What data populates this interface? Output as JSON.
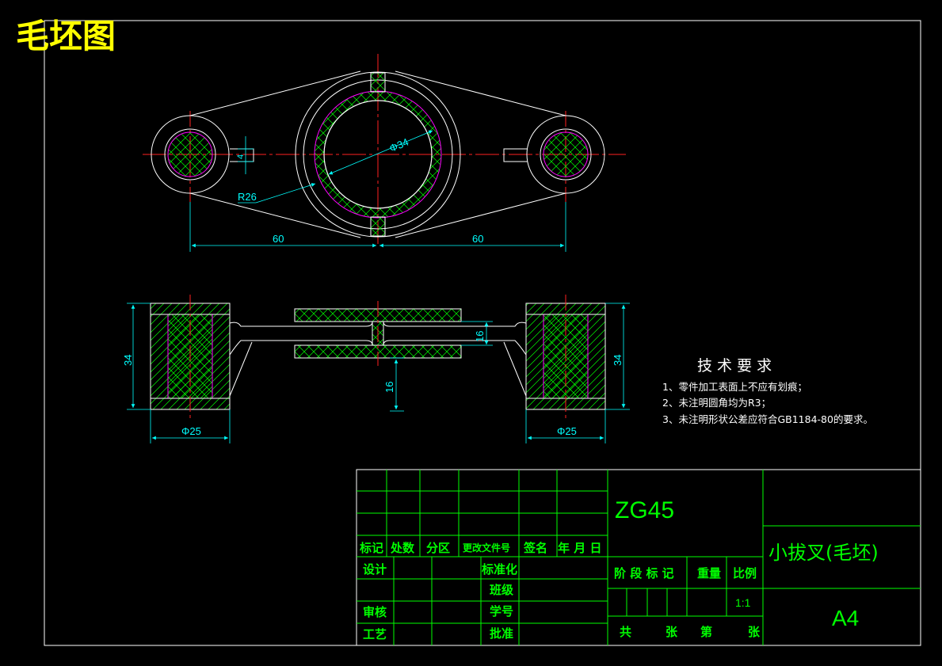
{
  "drawing": {
    "title": "毛坯图",
    "colors": {
      "background": "#000000",
      "outline": "#ffffff",
      "dimension": "#00ffff",
      "hatch": "#00ff00",
      "centerline": "#ff2020",
      "inner": "#ff00ff",
      "title_text": "#ffff00",
      "table": "#00ff00"
    },
    "dimensions": {
      "top_left_span": "60",
      "top_right_span": "60",
      "bore_diameter": "Φ34",
      "arc_radius": "R26",
      "slot_width": "4",
      "left_height": "34",
      "right_height": "34",
      "web_thickness": "16",
      "hub_height": "16",
      "left_boss_dia": "Φ25",
      "right_boss_dia": "Φ25"
    },
    "tech_requirements": {
      "heading": "技 术 要 求",
      "items": [
        "1、零件加工表面上不应有划痕；",
        "2、未注明圆角均为R3；",
        "3、未注明形状公差应符合GB1184-80的要求。"
      ]
    }
  },
  "title_block": {
    "material": "ZG45",
    "part_name": "小拔叉(毛坯)",
    "sheet_size": "A4",
    "rev_headers": [
      "标记",
      "处数",
      "分区",
      "更改文件号",
      "签名",
      "年 月 日"
    ],
    "roles": {
      "design": "设计",
      "standard": "标准化",
      "class": "班级",
      "review": "审核",
      "student_no": "学号",
      "process": "工艺",
      "approve": "批准"
    },
    "stage_label": "阶 段 标 记",
    "weight_label": "重量",
    "scale_label": "比例",
    "scale_value": "1:1",
    "sheet_total": "共",
    "sheet_unit_1": "张",
    "sheet_index": "第",
    "sheet_unit_2": "张"
  }
}
